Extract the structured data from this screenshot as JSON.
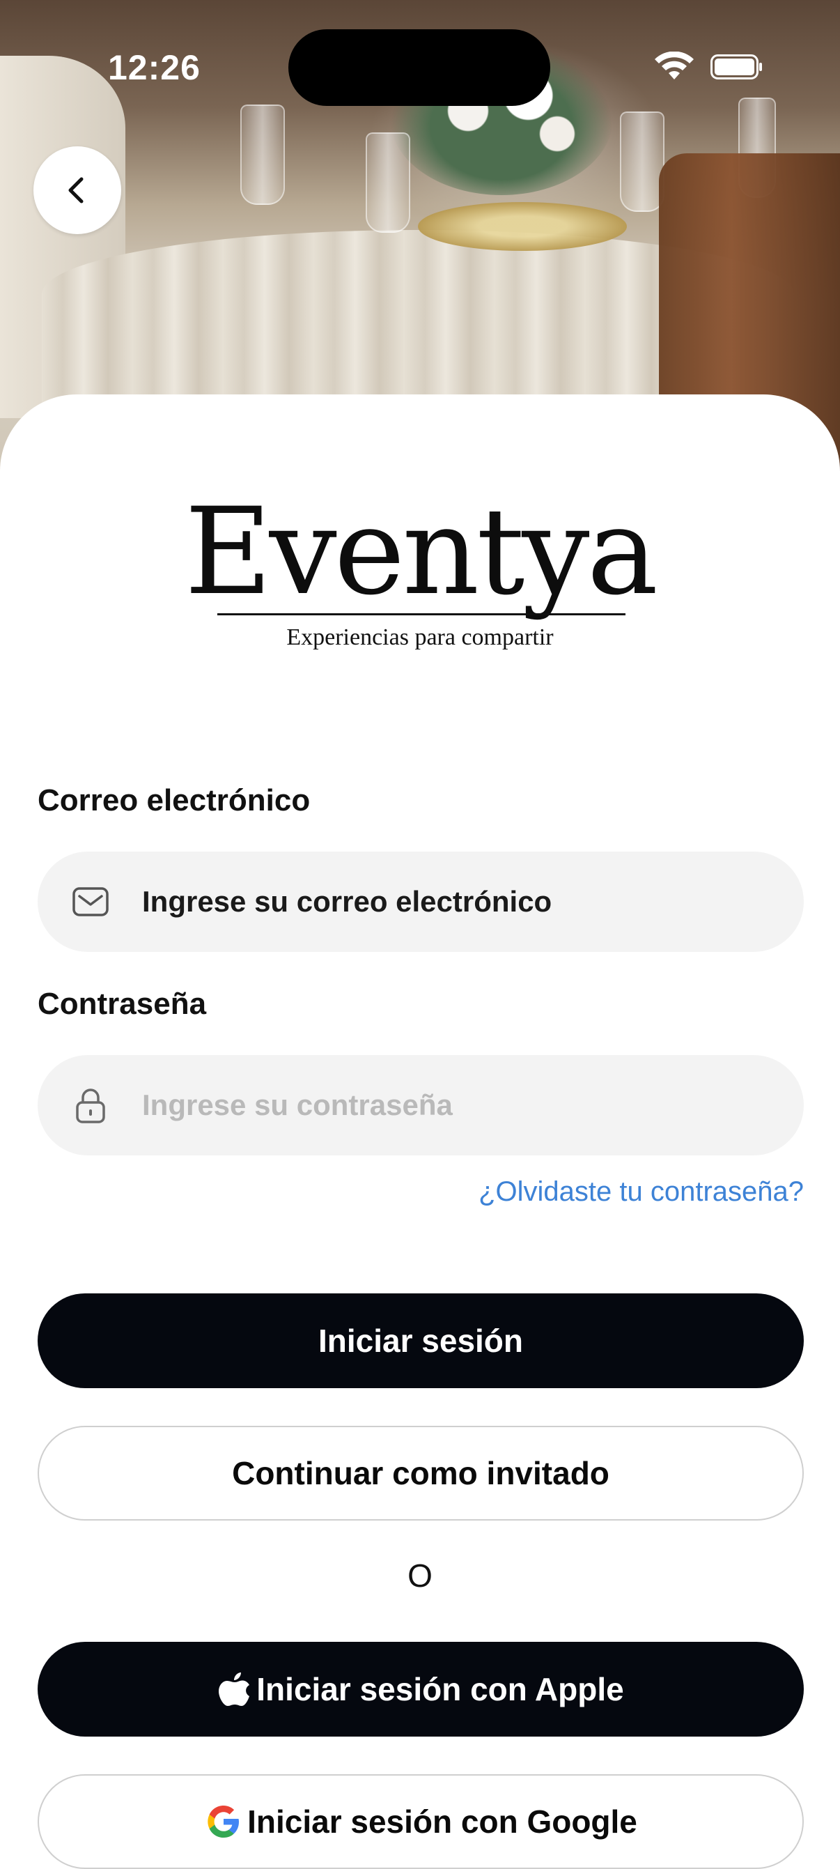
{
  "status_bar": {
    "time": "12:26"
  },
  "logo": {
    "name": "Eventya",
    "tagline": "Experiencias para compartir"
  },
  "form": {
    "email_label": "Correo electrónico",
    "email_placeholder": "Ingrese su correo electrónico",
    "password_label": "Contraseña",
    "password_placeholder": "Ingrese su contraseña",
    "forgot_password": "¿Olvidaste tu contraseña?"
  },
  "buttons": {
    "login": "Iniciar sesión",
    "guest": "Continuar como invitado",
    "or": "O",
    "apple": "Iniciar sesión con Apple",
    "google": "Iniciar sesión con Google"
  },
  "colors": {
    "primary_button": "#05080f",
    "link": "#3d82d6",
    "input_background": "#f3f3f3"
  }
}
